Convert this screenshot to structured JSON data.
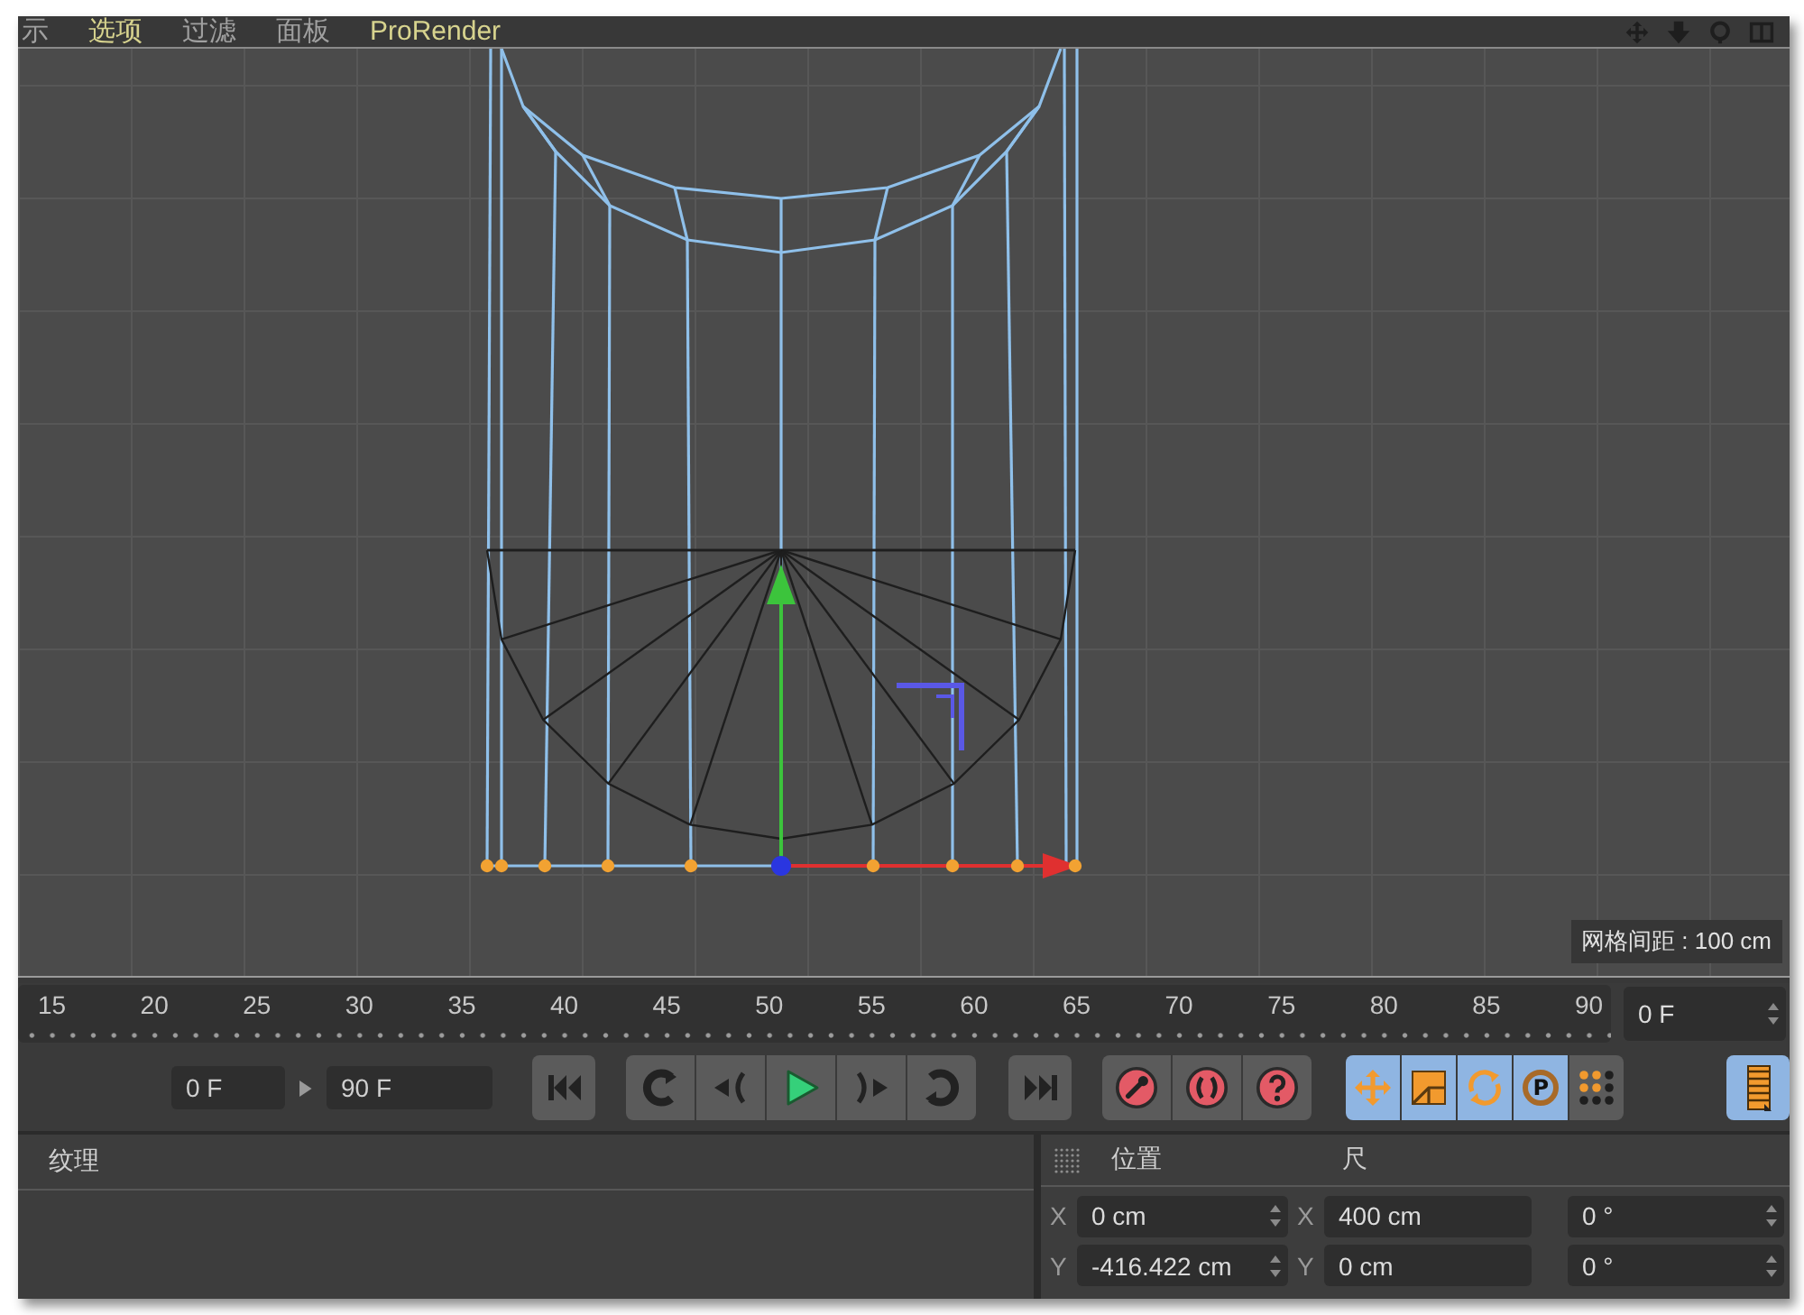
{
  "menu_bar": {
    "items": [
      {
        "label": "示",
        "highlighted": false
      },
      {
        "label": "选项",
        "highlighted": true
      },
      {
        "label": "过滤",
        "highlighted": false
      },
      {
        "label": "面板",
        "highlighted": false
      },
      {
        "label": "ProRender",
        "highlighted": true
      }
    ]
  },
  "viewport": {
    "grid_label": "网格间距 : 100 cm"
  },
  "timeline": {
    "ticks": [
      "15",
      "20",
      "25",
      "30",
      "35",
      "40",
      "45",
      "50",
      "55",
      "60",
      "65",
      "70",
      "75",
      "80",
      "85",
      "90"
    ],
    "frame_field": "0 F"
  },
  "transport": {
    "start_field": "0 F",
    "end_field": "90 F",
    "tools": [
      {
        "kind": "move",
        "selected": true
      },
      {
        "kind": "scale",
        "selected": true
      },
      {
        "kind": "rotate",
        "selected": true
      },
      {
        "kind": "param",
        "label": "P",
        "selected": true
      },
      {
        "kind": "points",
        "selected": false
      }
    ],
    "layout_button": {
      "selected": true
    }
  },
  "material_panel": {
    "title": "纹理"
  },
  "coordinates": {
    "headers": [
      "位置",
      "尺"
    ],
    "rows": [
      {
        "label": "X",
        "position": "0 cm",
        "size_label": "X",
        "size": "400 cm",
        "rotation": "0 °"
      },
      {
        "label": "Y",
        "position": "-416.422 cm",
        "size_label": "Y",
        "size": "0 cm",
        "rotation": "0 °"
      }
    ]
  }
}
